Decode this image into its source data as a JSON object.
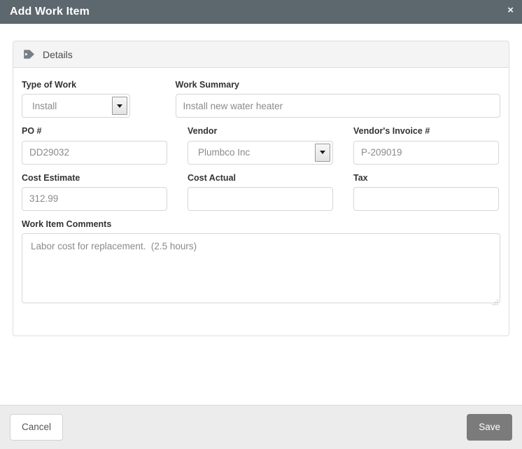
{
  "window": {
    "title": "Add Work Item",
    "close_label": "×",
    "header_bg": "#5d676e"
  },
  "panel": {
    "icon": "tag-icon",
    "title": "Details"
  },
  "form": {
    "type_of_work": {
      "label": "Type of Work",
      "value": "Install",
      "control": "select"
    },
    "work_summary": {
      "label": "Work Summary",
      "value": "Install new water heater",
      "placeholder": "Install new water heater",
      "control": "text"
    },
    "po_number": {
      "label": "PO #",
      "value": "DD29032",
      "placeholder": "DD29032",
      "control": "text"
    },
    "vendor": {
      "label": "Vendor",
      "value": "Plumbco Inc",
      "control": "select"
    },
    "vendor_invoice": {
      "label": "Vendor's Invoice #",
      "value": "P-209019",
      "placeholder": "P-209019",
      "control": "text"
    },
    "cost_estimate": {
      "label": "Cost Estimate",
      "value": "312.99",
      "placeholder": "312.99",
      "control": "text"
    },
    "cost_actual": {
      "label": "Cost Actual",
      "value": "",
      "placeholder": "",
      "control": "text"
    },
    "tax": {
      "label": "Tax",
      "value": "",
      "placeholder": "",
      "control": "text"
    },
    "comments": {
      "label": "Work Item Comments",
      "value": "Labor cost for replacement.  (2.5 hours)",
      "placeholder": "Labor cost for replacement.  (2.5 hours)",
      "control": "textarea"
    }
  },
  "footer": {
    "cancel_label": "Cancel",
    "save_label": "Save",
    "save_bg": "#7b7b7b"
  }
}
